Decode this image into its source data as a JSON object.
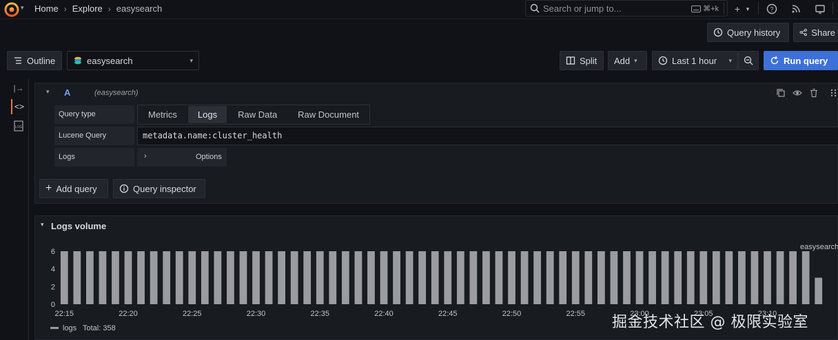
{
  "breadcrumb": {
    "home": "Home",
    "explore": "Explore",
    "current": "easysearch"
  },
  "search": {
    "placeholder": "Search or jump to...",
    "shortcut": "⌘+k"
  },
  "toolbar2": {
    "query_history": "Query history",
    "share": "Share"
  },
  "toolbar3": {
    "outline": "Outline",
    "datasource": "easysearch",
    "split": "Split",
    "add": "Add",
    "time_range": "Last 1 hour",
    "run_query": "Run query"
  },
  "query": {
    "ref_id": "A",
    "datasource_hint": "(easysearch)",
    "query_type_label": "Query type",
    "tabs": [
      "Metrics",
      "Logs",
      "Raw Data",
      "Raw Document"
    ],
    "active_tab": "Logs",
    "lucene_label": "Lucene Query",
    "lucene_value": "metadata.name:cluster_health",
    "logs_label": "Logs",
    "options_label": "Options",
    "add_query": "Add query",
    "query_inspector": "Query inspector"
  },
  "logs_volume": {
    "title": "Logs volume",
    "legend_label": "logs",
    "legend_total": "Total: 358"
  },
  "chart_data": {
    "type": "bar",
    "series": [
      {
        "name": "easysearch",
        "values": [
          6,
          6,
          6,
          6,
          6,
          6,
          6,
          6,
          6,
          6,
          6,
          6,
          6,
          6,
          6,
          6,
          6,
          6,
          6,
          6,
          6,
          6,
          6,
          6,
          6,
          6,
          6,
          6,
          6,
          6,
          6,
          6,
          6,
          6,
          6,
          6,
          6,
          6,
          6,
          6,
          6,
          6,
          6,
          6,
          6,
          6,
          6,
          6,
          6,
          6,
          6,
          6,
          6,
          6,
          6,
          6,
          6,
          6,
          6,
          3
        ]
      }
    ],
    "yticks": [
      0,
      2,
      4,
      6
    ],
    "ylim": [
      0,
      6
    ],
    "xticks": [
      "22:15",
      "22:20",
      "22:25",
      "22:30",
      "22:35",
      "22:40",
      "22:45",
      "22:50",
      "22:55",
      "23:00",
      "23:05",
      "23:10"
    ],
    "legend": "bottom-left",
    "colors": {
      "bar": "#9b9ca1"
    }
  },
  "watermark": "掘金技术社区 @ 极限实验室",
  "colors": {
    "run_query_bg": "#3d71d9",
    "accent": "#f2754b"
  },
  "icons": [
    "grafana-logo-icon",
    "search-icon",
    "keyboard-icon",
    "plus-icon",
    "help-icon",
    "rss-icon",
    "monitor-icon",
    "history-icon",
    "share-icon",
    "outline-icon",
    "datasource-icon",
    "split-icon",
    "clock-icon",
    "zoom-out-icon",
    "refresh-icon",
    "collapse-icon",
    "code-icon",
    "logs-icon",
    "copy-icon",
    "eye-icon",
    "trash-icon",
    "drag-icon",
    "info-icon"
  ]
}
